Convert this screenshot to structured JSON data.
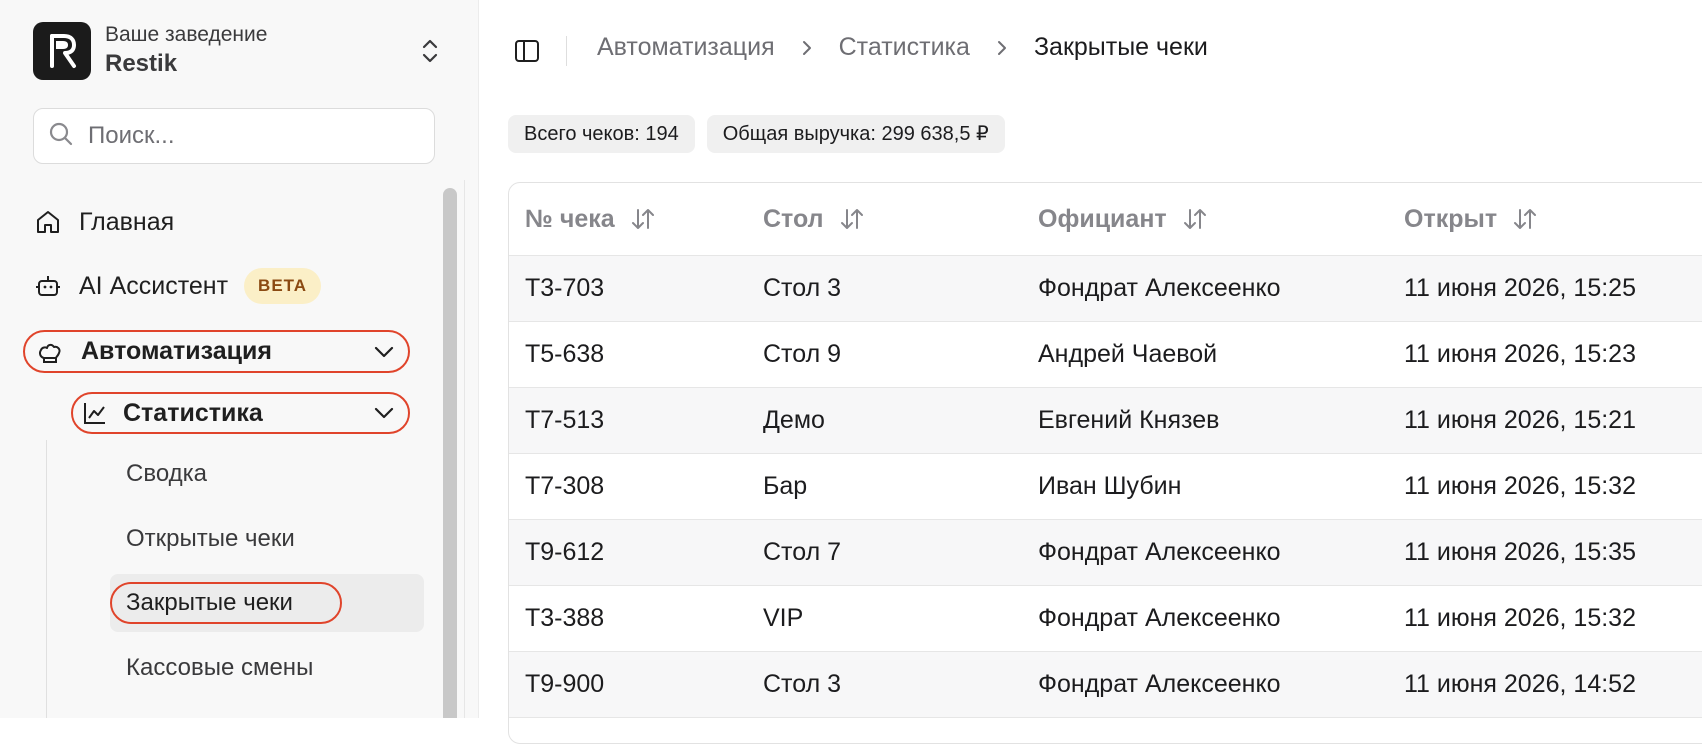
{
  "org": {
    "subtitle": "Ваше заведение",
    "name": "Restik"
  },
  "search": {
    "placeholder": "Поиск..."
  },
  "nav": {
    "home": "Главная",
    "ai": "AI Ассистент",
    "beta": "BETA",
    "automation": "Автоматизация",
    "statistics": "Статистика",
    "sub": [
      "Сводка",
      "Открытые чеки",
      "Закрытые чеки",
      "Кассовые смены"
    ]
  },
  "breadcrumb": [
    "Автоматизация",
    "Статистика",
    "Закрытые чеки"
  ],
  "stats": {
    "total_checks": "Всего чеков: 194",
    "revenue": "Общая выручка: 299 638,5 ₽"
  },
  "table": {
    "columns": [
      "№ чека",
      "Стол",
      "Официант",
      "Открыт"
    ],
    "rows": [
      [
        "T3-703",
        "Стол 3",
        "Фондрат Алексеенко",
        "11 июня 2026, 15:25"
      ],
      [
        "T5-638",
        "Стол 9",
        "Андрей Чаевой",
        "11 июня 2026, 15:23"
      ],
      [
        "T7-513",
        "Демо",
        "Евгений Князев",
        "11 июня 2026, 15:21"
      ],
      [
        "T7-308",
        "Бар",
        "Иван Шубин",
        "11 июня 2026, 15:32"
      ],
      [
        "T9-612",
        "Стол 7",
        "Фондрат Алексеенко",
        "11 июня 2026, 15:35"
      ],
      [
        "T3-388",
        "VIP",
        "Фондрат Алексеенко",
        "11 июня 2026, 15:32"
      ],
      [
        "T9-900",
        "Стол 3",
        "Фондрат Алексеенко",
        "11 июня 2026, 14:52"
      ]
    ]
  },
  "colors": {
    "highlight": "#e0442b",
    "beta_bg": "#fbefc7",
    "beta_text": "#8b4a12"
  }
}
